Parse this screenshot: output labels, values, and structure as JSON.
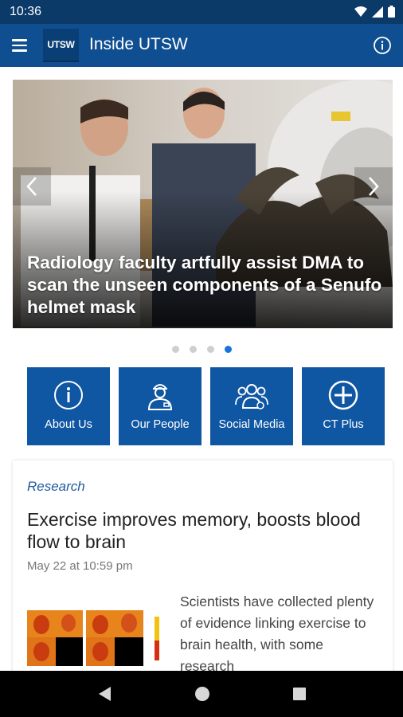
{
  "status_bar": {
    "time": "10:36"
  },
  "app_bar": {
    "logo_text": "UTSW",
    "title": "Inside UTSW"
  },
  "hero": {
    "caption": "Radiology faculty artfully assist DMA to scan the unseen components of a Senufo helmet mask",
    "slide_count": 4,
    "active_slide": 4
  },
  "tiles": [
    {
      "label": "About Us",
      "icon": "info-circle-icon"
    },
    {
      "label": "Our People",
      "icon": "person-icon"
    },
    {
      "label": "Social Media",
      "icon": "people-group-icon"
    },
    {
      "label": "CT Plus",
      "icon": "plus-circle-icon"
    }
  ],
  "article": {
    "category": "Research",
    "title": "Exercise improves memory, boosts blood flow to brain",
    "date": "May 22 at 10:59 pm",
    "snippet": "Scientists have collected plenty of evidence linking exercise to brain health, with some research"
  },
  "colors": {
    "status_bar": "#0b3968",
    "app_bar": "#0f4f91",
    "tile": "#0f56a3",
    "accent_dot": "#1a73d9"
  }
}
